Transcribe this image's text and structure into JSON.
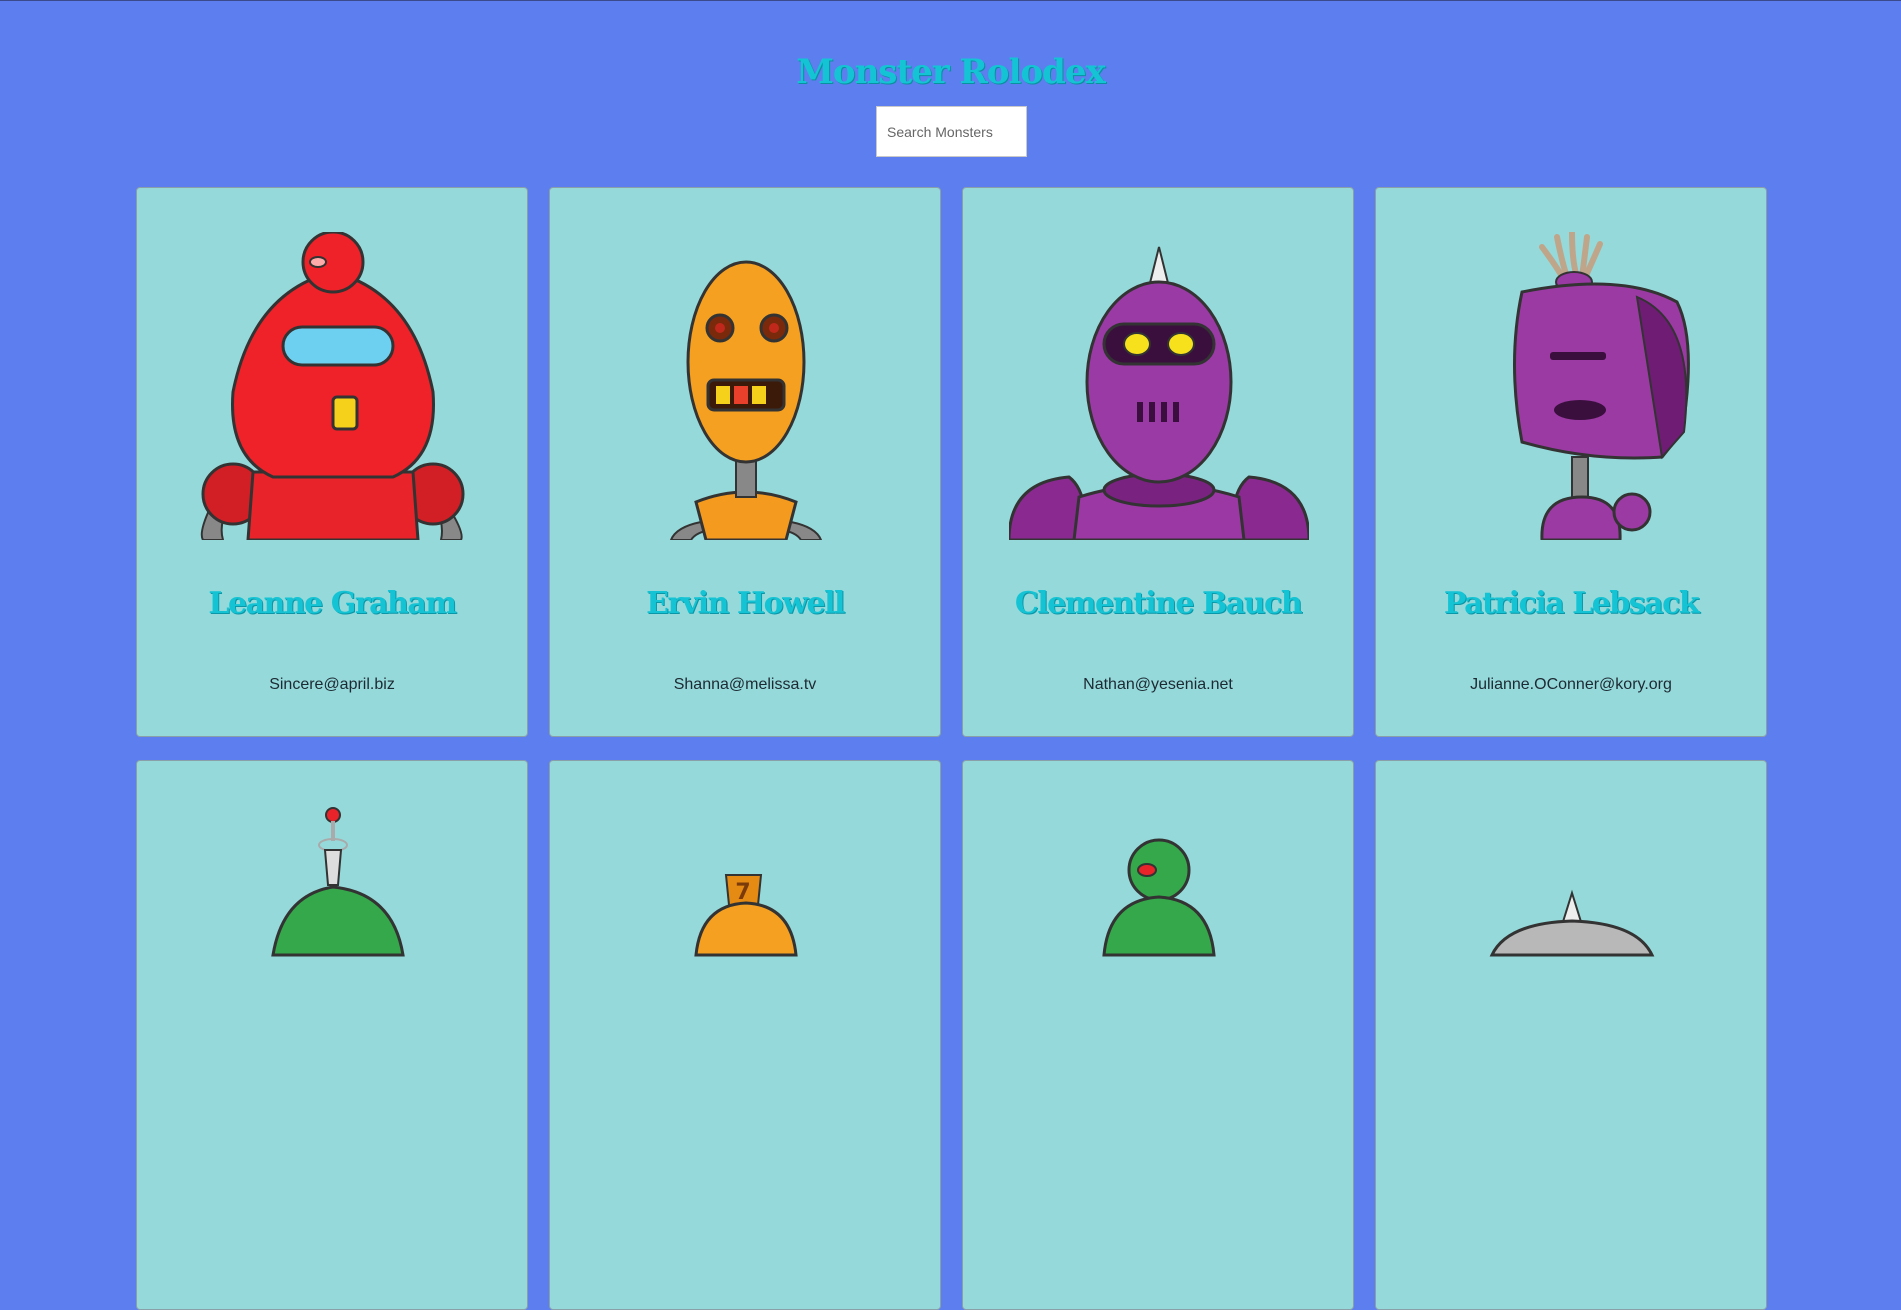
{
  "header": {
    "title": "Monster Rolodex"
  },
  "search": {
    "placeholder": "Search Monsters"
  },
  "colors": {
    "background": "#5d7eee",
    "card": "#95d9da",
    "accent": "#14c4d4"
  },
  "monsters": [
    {
      "name": "Leanne Graham",
      "email": "Sincere@april.biz",
      "robot": "red-robot-icon"
    },
    {
      "name": "Ervin Howell",
      "email": "Shanna@melissa.tv",
      "robot": "orange-robot-icon"
    },
    {
      "name": "Clementine Bauch",
      "email": "Nathan@yesenia.net",
      "robot": "purple-robot-icon"
    },
    {
      "name": "Patricia Lebsack",
      "email": "Julianne.OConner@kory.org",
      "robot": "purple-bucket-robot-icon"
    },
    {
      "name": "",
      "email": "",
      "robot": "green-antenna-robot-icon"
    },
    {
      "name": "",
      "email": "",
      "robot": "orange-seven-robot-icon"
    },
    {
      "name": "",
      "email": "",
      "robot": "green-dome-robot-icon"
    },
    {
      "name": "",
      "email": "",
      "robot": "gray-robot-icon"
    }
  ]
}
